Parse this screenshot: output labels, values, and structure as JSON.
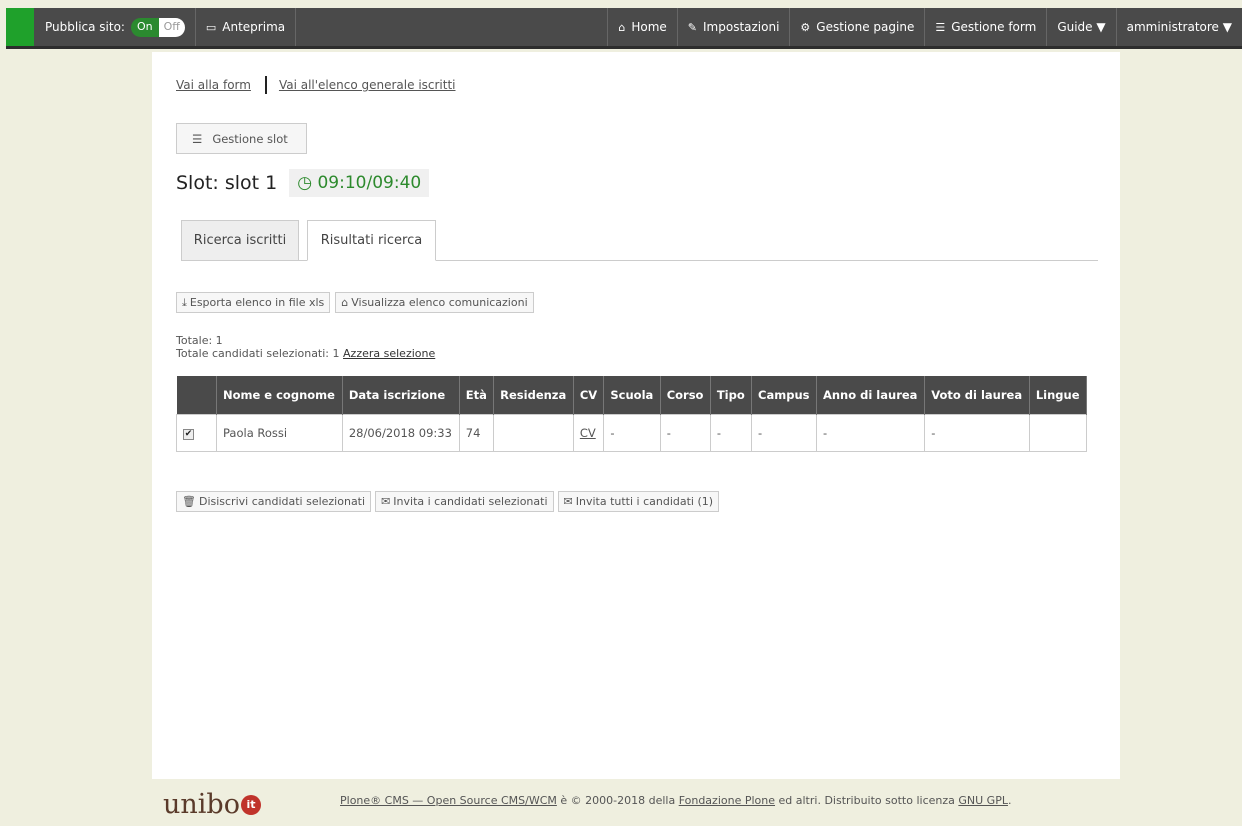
{
  "toolbar": {
    "publish_label": "Pubblica sito:",
    "toggle_on": "On",
    "toggle_off": "Off",
    "preview": "Anteprima",
    "home": "Home",
    "settings": "Impostazioni",
    "pages": "Gestione pagine",
    "forms": "Gestione form",
    "guide": "Guide ▼",
    "user": "amministratore ▼"
  },
  "links": {
    "go_form": "Vai alla form",
    "general_list": "Vai all'elenco generale iscritti"
  },
  "slot_button": "Gestione slot",
  "slot": {
    "title": "Slot: slot 1",
    "time": "09:10/09:40"
  },
  "tabs": [
    "Ricerca iscritti",
    "Risultati ricerca"
  ],
  "actions": {
    "export": "Esporta elenco in file xls",
    "view_comm": "Visualizza elenco comunicazioni"
  },
  "totals": {
    "total": "Totale: 1",
    "selected": "Totale candidati selezionati: 1",
    "reset": "Azzera selezione"
  },
  "table": {
    "headers": [
      "",
      "Nome e cognome",
      "Data iscrizione",
      "Età",
      "Residenza",
      "CV",
      "Scuola",
      "Corso",
      "Tipo",
      "Campus",
      "Anno di laurea",
      "Voto di laurea",
      "Lingue"
    ],
    "row": {
      "name": "Paola Rossi",
      "date": "28/06/2018 09:33",
      "age": "74",
      "residence": "",
      "cv": "CV",
      "school": "-",
      "course": "-",
      "type": "-",
      "campus": "-",
      "grad_year": "-",
      "grade": "-",
      "languages": ""
    }
  },
  "bottom": {
    "unsubscribe": "Disiscrivi candidati selezionati",
    "invite_selected": "Invita i candidati selezionati",
    "invite_all": "Invita tutti i candidati (1)"
  },
  "footer": {
    "logo": "unibo",
    "logo_dot": "it",
    "plone": "Plone® CMS — Open Source CMS/WCM",
    "mid": " è © 2000-2018 della ",
    "foundation": "Fondazione Plone",
    "end1": " ed altri. Distribuito sotto licenza ",
    "license": "GNU GPL",
    "end2": "."
  }
}
